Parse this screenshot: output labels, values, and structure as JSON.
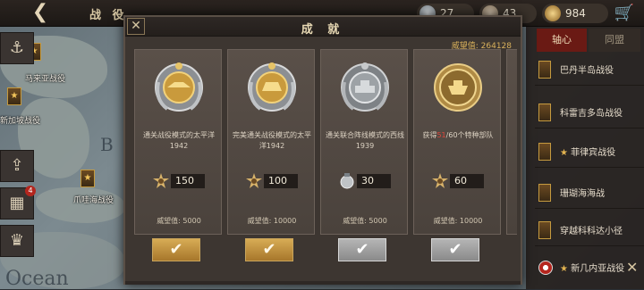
{
  "topbar": {
    "title": "战 役",
    "resources": [
      {
        "icon": "medal-silver-icon",
        "value": "27"
      },
      {
        "icon": "medal-bronze-icon",
        "value": "43"
      },
      {
        "icon": "star-medal-icon",
        "value": "984"
      }
    ]
  },
  "map": {
    "labels": [
      "马来亚战役",
      "新加坡战役",
      "爪哇海战役"
    ],
    "side_badge": "4",
    "water_text": "Ocean",
    "letter": "B"
  },
  "right_panel": {
    "tabs": [
      "轴心",
      "同盟"
    ],
    "items": [
      {
        "label": "巴丹半岛战役",
        "star": false
      },
      {
        "label": "科雷吉多岛战役",
        "star": false
      },
      {
        "label": "菲律宾战役",
        "star": true
      },
      {
        "label": "珊瑚海海战",
        "star": false
      },
      {
        "label": "穿越科科达小径",
        "star": false
      },
      {
        "label": "新几内亚战役",
        "star": true
      }
    ]
  },
  "modal": {
    "title": "成 就",
    "prestige_label": "威望值: ",
    "prestige_value": "264128",
    "cards": [
      {
        "desc": "通关战役模式的太平洋1942",
        "reward": "150",
        "reward_icon": "gold-star-medal-icon",
        "pv": "威望值: 5000",
        "claimed": true
      },
      {
        "desc": "完美通关战役模式的太平洋1942",
        "reward": "100",
        "reward_icon": "gold-star-medal-icon",
        "pv": "威望值: 10000",
        "claimed": true
      },
      {
        "desc": "通关联合阵线模式的西线1939",
        "reward": "30",
        "reward_icon": "silver-medal-icon",
        "pv": "威望值: 5000",
        "claimed": false
      },
      {
        "desc_pre": "获得",
        "desc_hl": "51",
        "desc_post": "/60个特种部队",
        "reward": "60",
        "reward_icon": "gold-star-medal-icon",
        "pv": "威望值: 10000",
        "claimed": false
      }
    ],
    "claim_mark": "✔"
  },
  "colors": {
    "accent_gold": "#d7ab55",
    "tab_red": "#6a1a14",
    "highlight_red": "#e0483c"
  }
}
